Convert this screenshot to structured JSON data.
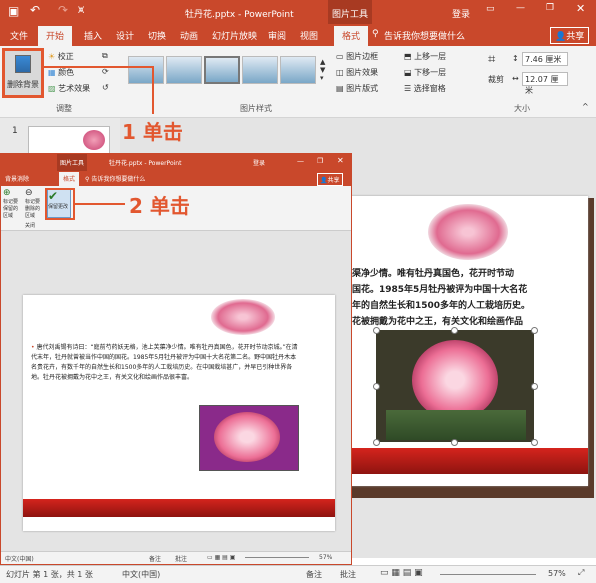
{
  "title_bar": {
    "doc_title": "牡丹花.pptx - PowerPoint",
    "tool_group": "图片工具",
    "login": "登录",
    "window_controls": [
      "minimize-icon",
      "restore-icon",
      "close-icon"
    ]
  },
  "tabs": [
    "文件",
    "开始",
    "插入",
    "设计",
    "切换",
    "动画",
    "幻灯片放映",
    "审阅",
    "视图",
    "格式"
  ],
  "tell_me": "告诉我你想要做什么",
  "share": "共享",
  "ribbon": {
    "remove_bg": "删除背景",
    "adjust": [
      "校正",
      "颜色",
      "艺术效果"
    ],
    "adjust_group": "调整",
    "styles_group": "图片样式",
    "style_opts": [
      "图片边框",
      "图片效果",
      "图片版式"
    ],
    "arrange": [
      "上移一层",
      "下移一层",
      "选择窗格"
    ],
    "size_group": "大小",
    "crop": "裁剪",
    "height": "7.46 厘米",
    "width": "12.07 厘米"
  },
  "slide_number": "1",
  "annotations": {
    "step1": "1 单击",
    "step2": "2 单击"
  },
  "win2": {
    "tool_group": "图片工具",
    "title": "牡丹花.pptx - PowerPoint",
    "login": "登录",
    "tabs": [
      "背景消除",
      "格式"
    ],
    "tell_me": "告诉我你想要做什么",
    "share": "共享",
    "buttons": [
      "标记要保留的区域",
      "标记要删除的区域",
      "删除标记",
      "放弃所有更改",
      "保留更改"
    ],
    "group": "关闭",
    "paragraph": "唐代刘禹锡有诗曰：“庭前芍药妖无格，池上芙蕖净少情。唯有牡丹真国色，花开时节动京城。”在清代末年，牡丹就曾被当作中国的国花。1985年5月牡丹被评为中国十大名花第二名。野中国牡丹木本名贵花卉，有数千年的自然生长和1500多年的人工栽培历史。在中国栽培甚广，并早已引种世界各地。牡丹花被拥戴为花中之王，有关文化和绘画作品很丰富。",
    "status_lang": "中文(中国)",
    "status_right": [
      "备注",
      "批注",
      "57%"
    ]
  },
  "big_slide_text": [
    "渠净少情。唯有牡丹真国色，花开时节动",
    "国花。1985年5月牡丹被评为中国十大名花",
    "年的自然生长和1500多年的人工栽培历史。",
    "花被拥戴为花中之王，有关文化和绘画作品"
  ],
  "status_bar": {
    "slide_info": "幻灯片 第 1 张，共 1 张",
    "lang": "中文(中国)",
    "notes": "备注",
    "comments": "批注",
    "zoom": "57%"
  }
}
